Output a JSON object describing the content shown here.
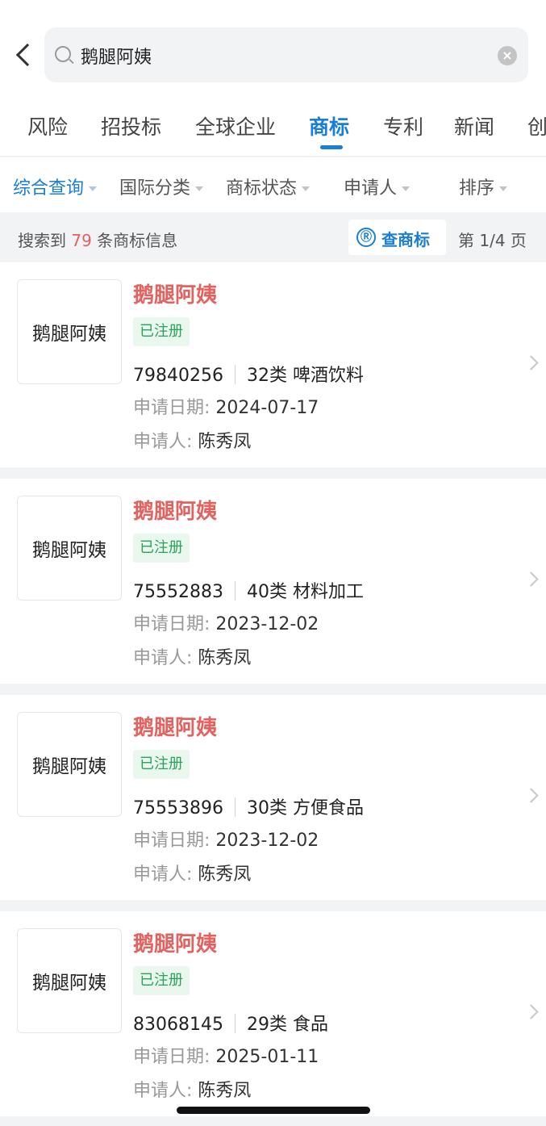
{
  "search": {
    "query": "鹅腿阿姨"
  },
  "tabs": [
    {
      "label": "风险"
    },
    {
      "label": "招投标"
    },
    {
      "label": "全球企业"
    },
    {
      "label": "商标"
    },
    {
      "label": "专利"
    },
    {
      "label": "新闻"
    },
    {
      "label": "创"
    }
  ],
  "active_tab": "商标",
  "filters": [
    {
      "label": "综合查询"
    },
    {
      "label": "国际分类"
    },
    {
      "label": "商标状态"
    },
    {
      "label": "申请人"
    },
    {
      "label": "排序"
    }
  ],
  "summary": {
    "prefix": "搜索到",
    "count": "79",
    "suffix": "条商标信息",
    "check_icon": "Ⓡ",
    "check_label": "查商标",
    "page_indicator": "第 1/4 页"
  },
  "labels": {
    "date_label": "申请日期:",
    "applicant_label": "申请人:"
  },
  "results": [
    {
      "logo_text": "鹅腿阿姨",
      "name": "鹅腿阿姨",
      "status": "已注册",
      "reg_no": "79840256",
      "class": "32类 啤酒饮料",
      "date": "2024-07-17",
      "applicant": "陈秀凤"
    },
    {
      "logo_text": "鹅腿阿姨",
      "name": "鹅腿阿姨",
      "status": "已注册",
      "reg_no": "75552883",
      "class": "40类 材料加工",
      "date": "2023-12-02",
      "applicant": "陈秀凤"
    },
    {
      "logo_text": "鹅腿阿姨",
      "name": "鹅腿阿姨",
      "status": "已注册",
      "reg_no": "75553896",
      "class": "30类 方便食品",
      "date": "2023-12-02",
      "applicant": "陈秀凤"
    },
    {
      "logo_text": "鹅腿阿姨",
      "name": "鹅腿阿姨",
      "status": "已注册",
      "reg_no": "83068145",
      "class": "29类 食品",
      "date": "2025-01-11",
      "applicant": "陈秀凤"
    }
  ],
  "colors": {
    "accent_blue": "#1a7fd4",
    "trademark_red": "#e2625f",
    "status_green": "#29a35a",
    "status_bg": "#eaf7ef"
  },
  "icons": {
    "back": "back-arrow-icon",
    "search": "search-icon",
    "clear": "clear-icon",
    "dropdown": "caret-down-icon",
    "chevron": "chevron-right-icon",
    "registered": "registered-mark-icon"
  }
}
